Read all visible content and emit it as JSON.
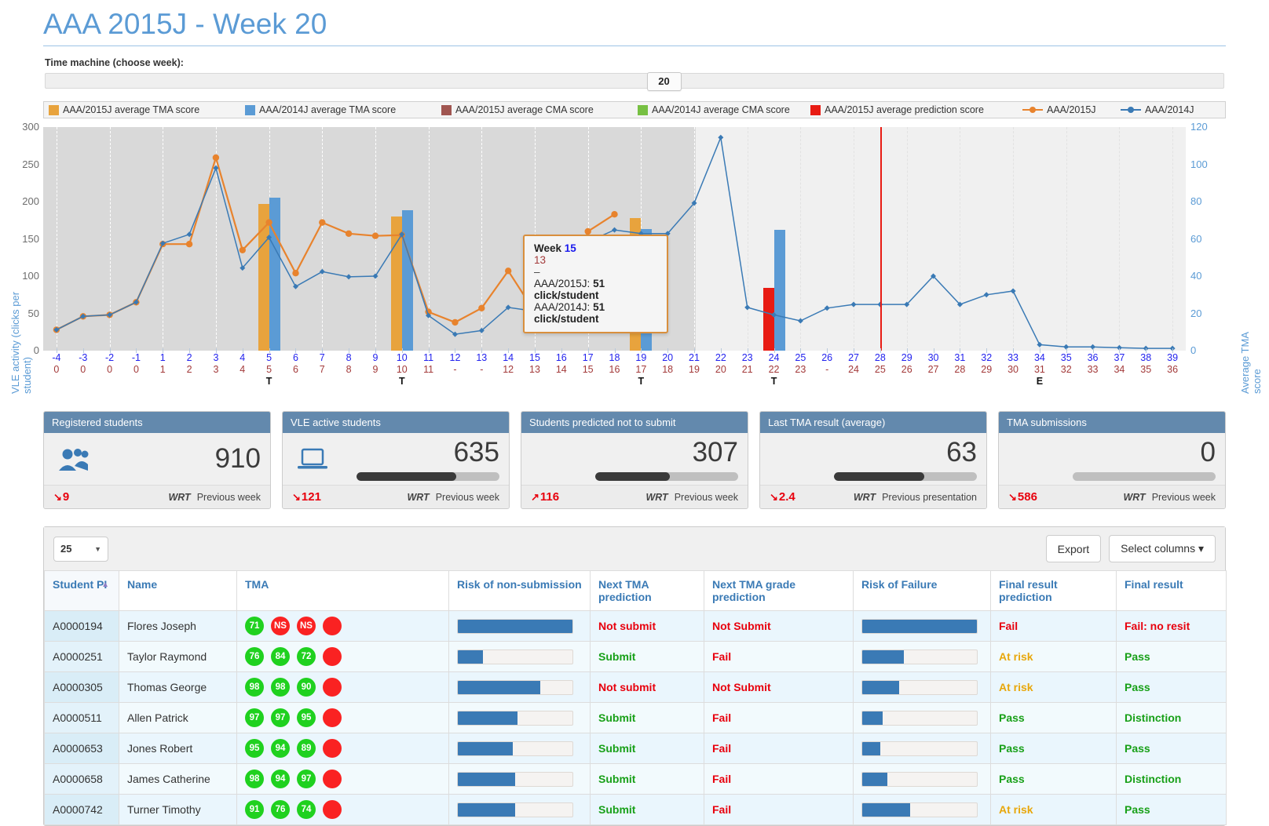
{
  "header": {
    "title": "AAA 2015J - Week 20",
    "time_machine_label": "Time machine (choose week):",
    "selected_week": "20"
  },
  "legend": [
    {
      "label": "AAA/2015J average TMA score",
      "color": "#e8a33d",
      "type": "swatch"
    },
    {
      "label": "AAA/2014J average TMA score",
      "color": "#5b9bd5",
      "type": "swatch"
    },
    {
      "label": "AAA/2015J average CMA score",
      "color": "#a05550",
      "type": "swatch"
    },
    {
      "label": "AAA/2014J average CMA score",
      "color": "#77c043",
      "type": "swatch"
    },
    {
      "label": "AAA/2015J average prediction score",
      "color": "#e81b13",
      "type": "swatch"
    },
    {
      "label": "AAA/2015J",
      "color": "#e8832d",
      "type": "line"
    },
    {
      "label": "AAA/2014J",
      "color": "#3a7ab5",
      "type": "line"
    }
  ],
  "chart_data": {
    "type": "line",
    "title": "",
    "ylabel": "VLE activity (clicks per student)",
    "ylabel_right": "Average TMA score",
    "ylim": [
      0,
      300
    ],
    "yticks": [
      0,
      50,
      100,
      150,
      200,
      250,
      300
    ],
    "ylim_right": [
      0,
      120
    ],
    "yticks_right": [
      0,
      20,
      40,
      60,
      80,
      100,
      120
    ],
    "grid": true,
    "legend_position": "top",
    "x": [
      -4,
      -3,
      -2,
      -1,
      1,
      2,
      3,
      4,
      5,
      6,
      7,
      8,
      9,
      10,
      11,
      12,
      13,
      14,
      15,
      16,
      17,
      18,
      19,
      20,
      21,
      22,
      23,
      24,
      25,
      26,
      27,
      28,
      29,
      30,
      31,
      32,
      33,
      34,
      35,
      36,
      37,
      38,
      39
    ],
    "x_row2": [
      "0",
      "0",
      "0",
      "0",
      "1",
      "2",
      "3",
      "4",
      "5",
      "6",
      "7",
      "8",
      "9",
      "10",
      "11",
      "-",
      "-",
      "12",
      "13",
      "14",
      "15",
      "16",
      "17",
      "18",
      "19",
      "20",
      "21",
      "22",
      "23",
      "-",
      "24",
      "25",
      "26",
      "27",
      "28",
      "29",
      "30",
      "31",
      "32",
      "33",
      "34",
      "35",
      "36"
    ],
    "x_row3": [
      "",
      "",
      "",
      "",
      "",
      "",
      "",
      "",
      "T",
      "",
      "",
      "",
      "",
      "T",
      "",
      "",
      "",
      "",
      "",
      "",
      "",
      "",
      "T",
      "",
      "",
      "",
      "",
      "T",
      "",
      "",
      "",
      "",
      "",
      "",
      "",
      "",
      "",
      "E",
      "",
      "",
      "",
      "",
      ""
    ],
    "series": [
      {
        "name": "AAA/2015J",
        "color": "#e8832d",
        "values": [
          28,
          46,
          48,
          65,
          143,
          143,
          259,
          135,
          172,
          104,
          172,
          157,
          154,
          155,
          52,
          38,
          57,
          107,
          52,
          51,
          160,
          183,
          null,
          null,
          null,
          null,
          null,
          null,
          null,
          null,
          null,
          null,
          null,
          null,
          null,
          null,
          null,
          null,
          null,
          null,
          null,
          null,
          null
        ]
      },
      {
        "name": "AAA/2014J",
        "color": "#3a7ab5",
        "values": [
          28,
          46,
          48,
          65,
          144,
          156,
          245,
          111,
          152,
          86,
          106,
          99,
          100,
          156,
          47,
          22,
          27,
          58,
          53,
          51,
          146,
          162,
          157,
          157,
          198,
          286,
          58,
          48,
          40,
          57,
          62,
          62,
          62,
          100,
          62,
          75,
          80,
          8,
          5,
          5,
          4,
          3,
          3
        ]
      }
    ],
    "bars": [
      {
        "week": 5,
        "series": "AAA/2015J average TMA score",
        "value": 197,
        "color": "#e8a33d"
      },
      {
        "week": 5,
        "series": "AAA/2014J average TMA score",
        "value": 205,
        "color": "#5b9bd5"
      },
      {
        "week": 10,
        "series": "AAA/2015J average TMA score",
        "value": 180,
        "color": "#e8a33d"
      },
      {
        "week": 10,
        "series": "AAA/2014J average TMA score",
        "value": 188,
        "color": "#5b9bd5"
      },
      {
        "week": 19,
        "series": "AAA/2015J average TMA score",
        "value": 178,
        "color": "#e8a33d"
      },
      {
        "week": 19,
        "series": "AAA/2014J average TMA score",
        "value": 163,
        "color": "#5b9bd5"
      },
      {
        "week": 24,
        "series": "AAA/2015J average prediction score",
        "value": 84,
        "color": "#e81b13"
      },
      {
        "week": 24,
        "series": "AAA/2014J average TMA score",
        "value": 162,
        "color": "#5b9bd5"
      }
    ],
    "marker_line_week": 28,
    "marker_line_color": "#e81b13"
  },
  "tooltip": {
    "week_label": "Week",
    "week_value": "15",
    "sub_value": "13",
    "dash": "–",
    "rows": [
      {
        "name": "AAA/2015J: ",
        "value": "51 click/student"
      },
      {
        "name": "AAA/2014J: ",
        "value": "51 click/student"
      }
    ]
  },
  "cards": [
    {
      "title": "Registered students",
      "value": "910",
      "icon": "users-icon",
      "has_bar": false,
      "bar_pct": 0,
      "delta_arrow": "↘",
      "delta": "9",
      "wrt": "WRT",
      "wrt_ref": "Previous week"
    },
    {
      "title": "VLE active students",
      "value": "635",
      "icon": "laptop-icon",
      "has_bar": true,
      "bar_pct": 70,
      "delta_arrow": "↘",
      "delta": "121",
      "wrt": "WRT",
      "wrt_ref": "Previous week"
    },
    {
      "title": "Students predicted not to submit",
      "value": "307",
      "icon": "",
      "has_bar": true,
      "bar_pct": 52,
      "delta_arrow": "↗",
      "delta": "116",
      "wrt": "WRT",
      "wrt_ref": "Previous week"
    },
    {
      "title": "Last TMA result (average)",
      "value": "63",
      "icon": "",
      "has_bar": true,
      "bar_pct": 63,
      "delta_arrow": "↘",
      "delta": "2.4",
      "wrt": "WRT",
      "wrt_ref": "Previous presentation"
    },
    {
      "title": "TMA submissions",
      "value": "0",
      "icon": "",
      "has_bar": true,
      "bar_pct": 0,
      "delta_arrow": "↘",
      "delta": "586",
      "wrt": "WRT",
      "wrt_ref": "Previous week"
    }
  ],
  "table": {
    "page_size": "25",
    "export_label": "Export",
    "select_columns_label": "Select columns",
    "columns": [
      "Student PI",
      "Name",
      "TMA",
      "Risk of non-submission",
      "Next TMA prediction",
      "Next TMA grade prediction",
      "Risk of Failure",
      "Final result prediction",
      "Final result"
    ],
    "rows": [
      {
        "pi": "A0000194",
        "name": "Flores Joseph",
        "tma": [
          {
            "v": "71",
            "c": "green"
          },
          {
            "v": "NS",
            "c": "red"
          },
          {
            "v": "NS",
            "c": "red"
          },
          {
            "v": "",
            "c": "red"
          }
        ],
        "risk_non_sub": 100,
        "next_tma": "Not submit",
        "next_tma_class": "txt-red",
        "next_grade": "Not Submit",
        "next_grade_class": "txt-red",
        "risk_fail": 100,
        "final_pred": "Fail",
        "final_pred_class": "txt-red",
        "final": "Fail: no resit",
        "final_class": "txt-red"
      },
      {
        "pi": "A0000251",
        "name": "Taylor Raymond",
        "tma": [
          {
            "v": "76",
            "c": "green"
          },
          {
            "v": "84",
            "c": "green"
          },
          {
            "v": "72",
            "c": "green"
          },
          {
            "v": "",
            "c": "red"
          }
        ],
        "risk_non_sub": 22,
        "next_tma": "Submit",
        "next_tma_class": "txt-green",
        "next_grade": "Fail",
        "next_grade_class": "txt-red",
        "risk_fail": 36,
        "final_pred": "At risk",
        "final_pred_class": "txt-amber",
        "final": "Pass",
        "final_class": "txt-green"
      },
      {
        "pi": "A0000305",
        "name": "Thomas George",
        "tma": [
          {
            "v": "98",
            "c": "green"
          },
          {
            "v": "98",
            "c": "green"
          },
          {
            "v": "90",
            "c": "green"
          },
          {
            "v": "",
            "c": "red"
          }
        ],
        "risk_non_sub": 72,
        "next_tma": "Not submit",
        "next_tma_class": "txt-red",
        "next_grade": "Not Submit",
        "next_grade_class": "txt-red",
        "risk_fail": 32,
        "final_pred": "At risk",
        "final_pred_class": "txt-amber",
        "final": "Pass",
        "final_class": "txt-green"
      },
      {
        "pi": "A0000511",
        "name": "Allen Patrick",
        "tma": [
          {
            "v": "97",
            "c": "green"
          },
          {
            "v": "97",
            "c": "green"
          },
          {
            "v": "95",
            "c": "green"
          },
          {
            "v": "",
            "c": "red"
          }
        ],
        "risk_non_sub": 52,
        "next_tma": "Submit",
        "next_tma_class": "txt-green",
        "next_grade": "Fail",
        "next_grade_class": "txt-red",
        "risk_fail": 18,
        "final_pred": "Pass",
        "final_pred_class": "txt-green",
        "final": "Distinction",
        "final_class": "txt-green"
      },
      {
        "pi": "A0000653",
        "name": "Jones Robert",
        "tma": [
          {
            "v": "95",
            "c": "green"
          },
          {
            "v": "94",
            "c": "green"
          },
          {
            "v": "89",
            "c": "green"
          },
          {
            "v": "",
            "c": "red"
          }
        ],
        "risk_non_sub": 48,
        "next_tma": "Submit",
        "next_tma_class": "txt-green",
        "next_grade": "Fail",
        "next_grade_class": "txt-red",
        "risk_fail": 16,
        "final_pred": "Pass",
        "final_pred_class": "txt-green",
        "final": "Pass",
        "final_class": "txt-green"
      },
      {
        "pi": "A0000658",
        "name": "James Catherine",
        "tma": [
          {
            "v": "98",
            "c": "green"
          },
          {
            "v": "94",
            "c": "green"
          },
          {
            "v": "97",
            "c": "green"
          },
          {
            "v": "",
            "c": "red"
          }
        ],
        "risk_non_sub": 50,
        "next_tma": "Submit",
        "next_tma_class": "txt-green",
        "next_grade": "Fail",
        "next_grade_class": "txt-red",
        "risk_fail": 22,
        "final_pred": "Pass",
        "final_pred_class": "txt-green",
        "final": "Distinction",
        "final_class": "txt-green"
      },
      {
        "pi": "A0000742",
        "name": "Turner Timothy",
        "tma": [
          {
            "v": "91",
            "c": "green"
          },
          {
            "v": "76",
            "c": "green"
          },
          {
            "v": "74",
            "c": "green"
          },
          {
            "v": "",
            "c": "red"
          }
        ],
        "risk_non_sub": 50,
        "next_tma": "Submit",
        "next_tma_class": "txt-green",
        "next_grade": "Fail",
        "next_grade_class": "txt-red",
        "risk_fail": 42,
        "final_pred": "At risk",
        "final_pred_class": "txt-amber",
        "final": "Pass",
        "final_class": "txt-green"
      }
    ]
  }
}
